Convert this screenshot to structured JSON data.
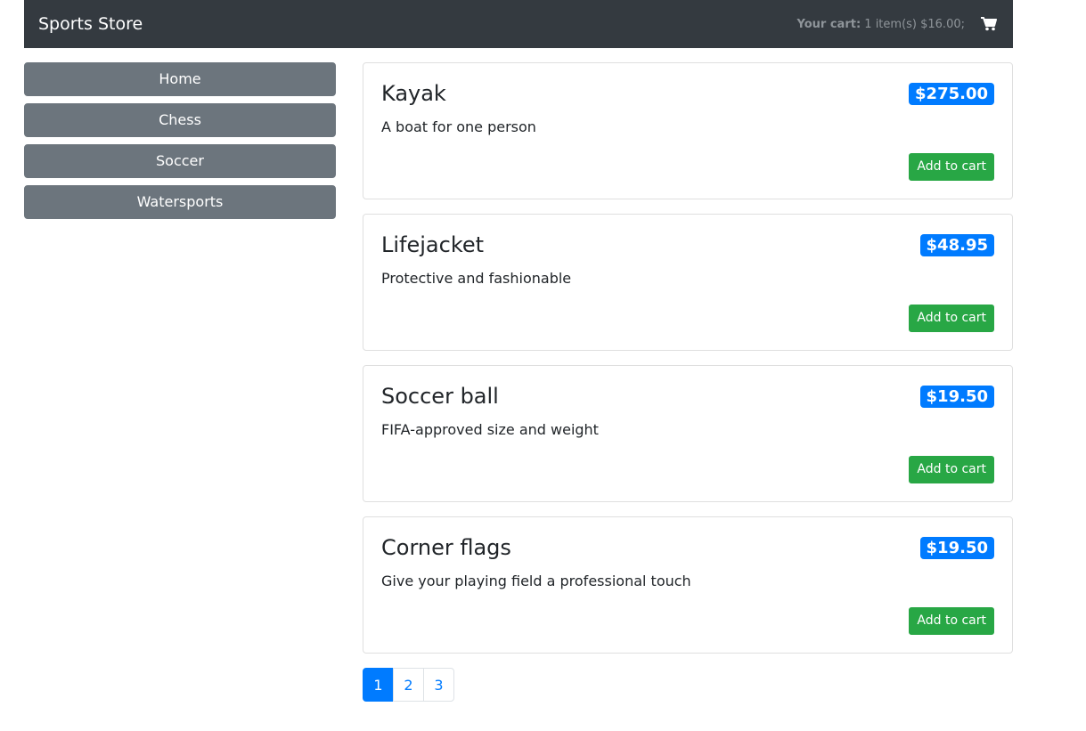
{
  "navbar": {
    "brand": "Sports Store",
    "cart_label": "Your cart:",
    "cart_details": "1 item(s) $16.00;",
    "cart_icon": "shopping-cart-icon"
  },
  "categories": [
    {
      "label": "Home"
    },
    {
      "label": "Chess"
    },
    {
      "label": "Soccer"
    },
    {
      "label": "Watersports"
    }
  ],
  "products": [
    {
      "name": "Kayak",
      "price": "$275.00",
      "description": "A boat for one person",
      "button": "Add to cart"
    },
    {
      "name": "Lifejacket",
      "price": "$48.95",
      "description": "Protective and fashionable",
      "button": "Add to cart"
    },
    {
      "name": "Soccer ball",
      "price": "$19.50",
      "description": "FIFA-approved size and weight",
      "button": "Add to cart"
    },
    {
      "name": "Corner flags",
      "price": "$19.50",
      "description": "Give your playing field a professional touch",
      "button": "Add to cart"
    }
  ],
  "pagination": {
    "pages": [
      "1",
      "2",
      "3"
    ],
    "current": "1"
  },
  "colors": {
    "navbar_bg": "#343a40",
    "category_button": "#6c757d",
    "price_badge": "#007bff",
    "add_button": "#28a745",
    "page_active": "#007bff"
  }
}
